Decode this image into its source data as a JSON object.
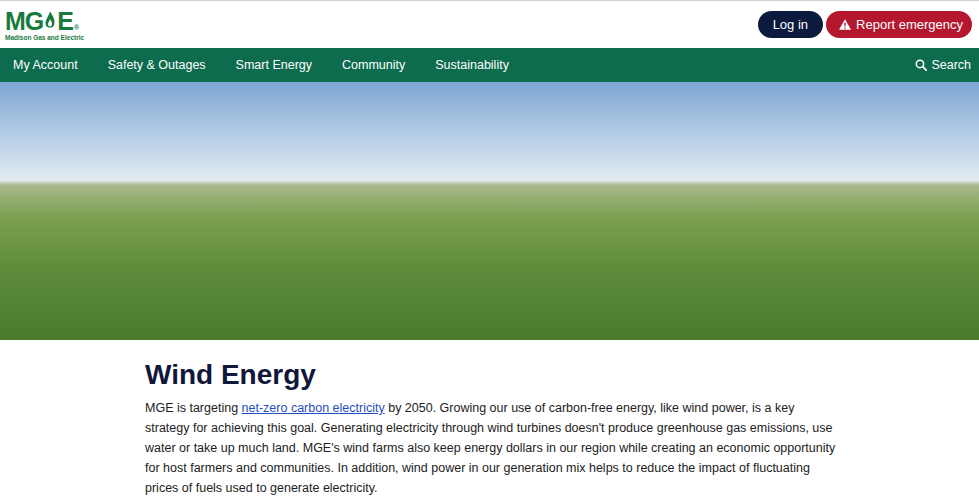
{
  "header": {
    "logo": {
      "mark": "MGE",
      "registered": "®",
      "name": "Madison Gas and Electric"
    },
    "buttons": [
      {
        "label": "Log in",
        "kind": "primary"
      },
      {
        "label": "Report emergency",
        "kind": "emergency"
      }
    ]
  },
  "nav": {
    "items": [
      "My Account",
      "Safety & Outages",
      "Smart Energy",
      "Community",
      "Sustainability"
    ],
    "search": "Search"
  },
  "article": {
    "title": "Wind Energy",
    "intro": [
      {
        "text": "MGE is targeting ",
        "link": false
      },
      {
        "text": "net-zero carbon electricity",
        "link": true
      },
      {
        "text": " by 2050. Growing our use of carbon-free energy, like wind power, is a key strategy for achieving this goal. Generating electricity through wind turbines doesn't produce greenhouse gas emissions, use water or take up much land. MGE's wind farms also keep energy dollars in our region while creating an economic opportunity for host farmers and communities. In addition, wind power in our generation mix helps to reduce the impact of fluctuating prices of fuels used to generate electricity.",
        "link": false
      }
    ]
  }
}
